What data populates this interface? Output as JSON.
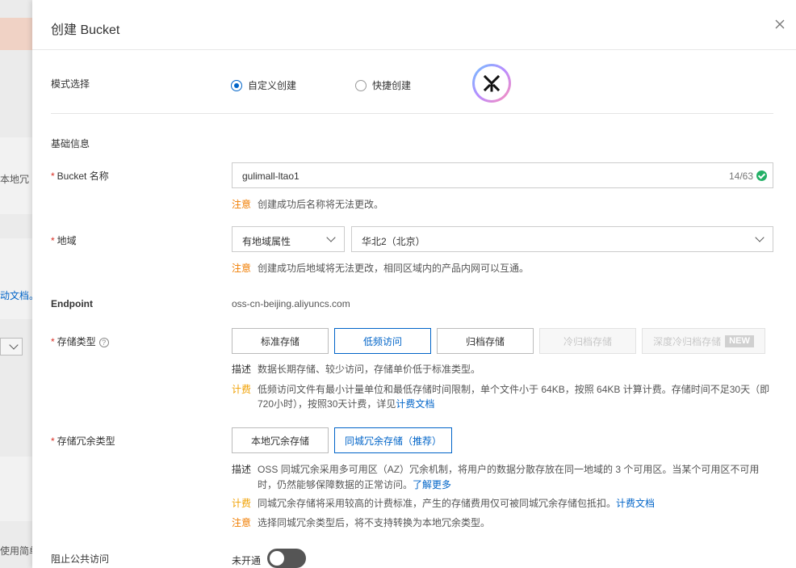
{
  "background": {
    "left_texts": [
      "本地冗",
      "动文档。",
      "使用简单"
    ]
  },
  "drawer": {
    "title": "创建 Bucket",
    "close_icon": "close-icon"
  },
  "mode": {
    "label": "模式选择",
    "options": [
      "自定义创建",
      "快捷创建"
    ],
    "selected": "自定义创建"
  },
  "basic_info": {
    "title": "基础信息"
  },
  "bucket_name": {
    "label": "Bucket 名称",
    "value": "gulimall-ltao1",
    "count": "14/63",
    "note_tag": "注意",
    "note": "创建成功后名称将无法更改。"
  },
  "region": {
    "label": "地域",
    "attr_select": "有地域属性",
    "region_select": "华北2（北京）",
    "note_tag": "注意",
    "note": "创建成功后地域将无法更改，相同区域内的产品内网可以互通。"
  },
  "endpoint": {
    "label": "Endpoint",
    "value": "oss-cn-beijing.aliyuncs.com"
  },
  "storage_type": {
    "label": "存储类型",
    "help_icon": "help-circle-icon",
    "options": [
      "标准存储",
      "低频访问",
      "归档存储",
      "冷归档存储",
      "深度冷归档存储"
    ],
    "new_tag": "NEW",
    "selected": "低频访问",
    "desc_tag": "描述",
    "desc": "数据长期存储、较少访问，存储单价低于标准类型。",
    "fee_tag": "计费",
    "fee_line1": "低频访问文件有最小计量单位和最低存储时间限制，单个文件小于 64KB，按照 64KB 计算计费。存储时间不足30天（即",
    "fee_line2": "720小时），按照30天计费，详见",
    "fee_link": "计费文档"
  },
  "redundancy": {
    "label": "存储冗余类型",
    "options": [
      "本地冗余存储",
      "同城冗余存储（推荐）"
    ],
    "selected": "同城冗余存储（推荐）",
    "desc_tag": "描述",
    "desc_line1": "OSS 同城冗余采用多可用区（AZ）冗余机制，将用户的数据分散存放在同一地域的 3 个可用区。当某个可用区不可用",
    "desc_line2": "时，仍然能够保障数据的正常访问。",
    "desc_link": "了解更多",
    "fee_tag": "计费",
    "fee": "同城冗余存储将采用较高的计费标准，产生的存储费用仅可被同城冗余存储包抵扣。",
    "fee_link": "计费文档",
    "note_tag": "注意",
    "note": "选择同城冗余类型后，将不支持转换为本地冗余类型。"
  },
  "public_access": {
    "label": "阻止公共访问",
    "state": "未开通",
    "enabled": false
  },
  "colors": {
    "accent": "#0064c8",
    "required": "#d93026",
    "warn": "#f07d00",
    "success": "#23b066"
  }
}
